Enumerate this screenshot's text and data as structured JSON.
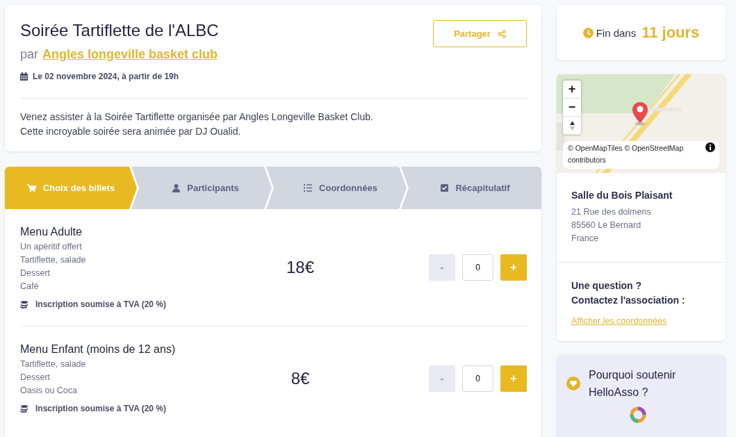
{
  "event": {
    "title": "Soirée Tartiflette de l'ALBC",
    "organizer_prefix": "par",
    "organizer": "Angles longeville basket club",
    "date": "Le 02 novembre 2024, à partir de 19h",
    "share_button": "Partager",
    "description": [
      "Venez assister à la Soirée Tartiflette organisée par Angles Longeville Basket Club.",
      "Cette incroyable soirée sera animée par DJ Oualid."
    ]
  },
  "steps": [
    {
      "label": "Choix des billets",
      "kind": "cart",
      "selected": true
    },
    {
      "label": "Participants",
      "kind": "person",
      "selected": false
    },
    {
      "label": "Coordonnées",
      "kind": "list",
      "selected": false
    },
    {
      "label": "Récapitulatif",
      "kind": "check",
      "selected": false
    }
  ],
  "tickets": [
    {
      "name": "Menu Adulte",
      "details": [
        "Un apéritif offert",
        "Tartiflette, salade",
        "Dessert",
        "Café"
      ],
      "vat_note": "Inscription soumise à TVA (20 %)",
      "price": "18€",
      "minus": "-",
      "quantity": "0",
      "plus": "+",
      "minus_disabled": true
    },
    {
      "name": "Menu Enfant (moins de 12 ans)",
      "details": [
        "Tartiflette, salade",
        "Dessert",
        "Oasis ou Coca"
      ],
      "vat_note": "Inscription soumise à TVA (20 %)",
      "price": "8€",
      "minus": "-",
      "quantity": "0",
      "plus": "+",
      "minus_disabled": true
    }
  ],
  "countdown": {
    "prefix": "Fin dans",
    "value": "11 jours"
  },
  "map": {
    "zoom_in": "+",
    "zoom_out": "−",
    "attribution": "© OpenMapTiles © OpenStreetMap contributors"
  },
  "venue": {
    "name": "Salle du Bois Plaisant",
    "address": [
      "21 Rue des dolmens",
      "85560 Le Bernard",
      "France"
    ]
  },
  "contact": {
    "question": "Une question ?",
    "prompt": "Contactez l'association :",
    "link": "Afficher les coordonnées"
  },
  "support": {
    "title": "Pourquoi soutenir HelloAsso ?"
  }
}
